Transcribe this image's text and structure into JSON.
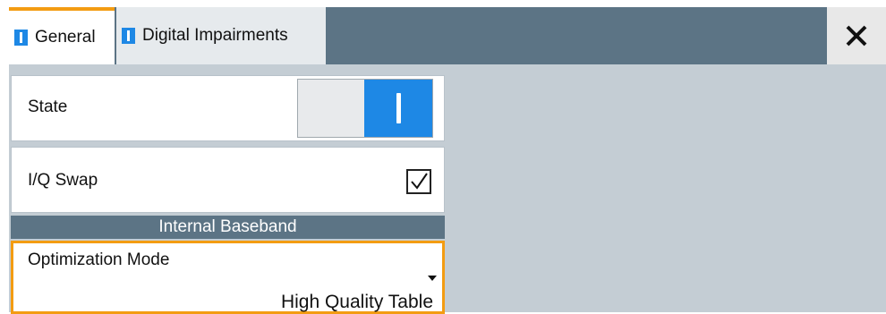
{
  "tabs": [
    {
      "label": "General",
      "active": true
    },
    {
      "label": "Digital Impairments",
      "active": false
    }
  ],
  "rows": {
    "state": {
      "label": "State",
      "value": "on"
    },
    "iq_swap": {
      "label": "I/Q Swap",
      "checked": true
    }
  },
  "section": {
    "title": "Internal Baseband"
  },
  "optimization": {
    "label": "Optimization Mode",
    "value": "High Quality Table"
  },
  "colors": {
    "accent": "#f39c12",
    "toggle_on": "#1e88e5",
    "header": "#5c7485"
  },
  "icons": {
    "close": "close-icon",
    "check": "check-icon",
    "dropdown": "chevron-down-icon"
  }
}
